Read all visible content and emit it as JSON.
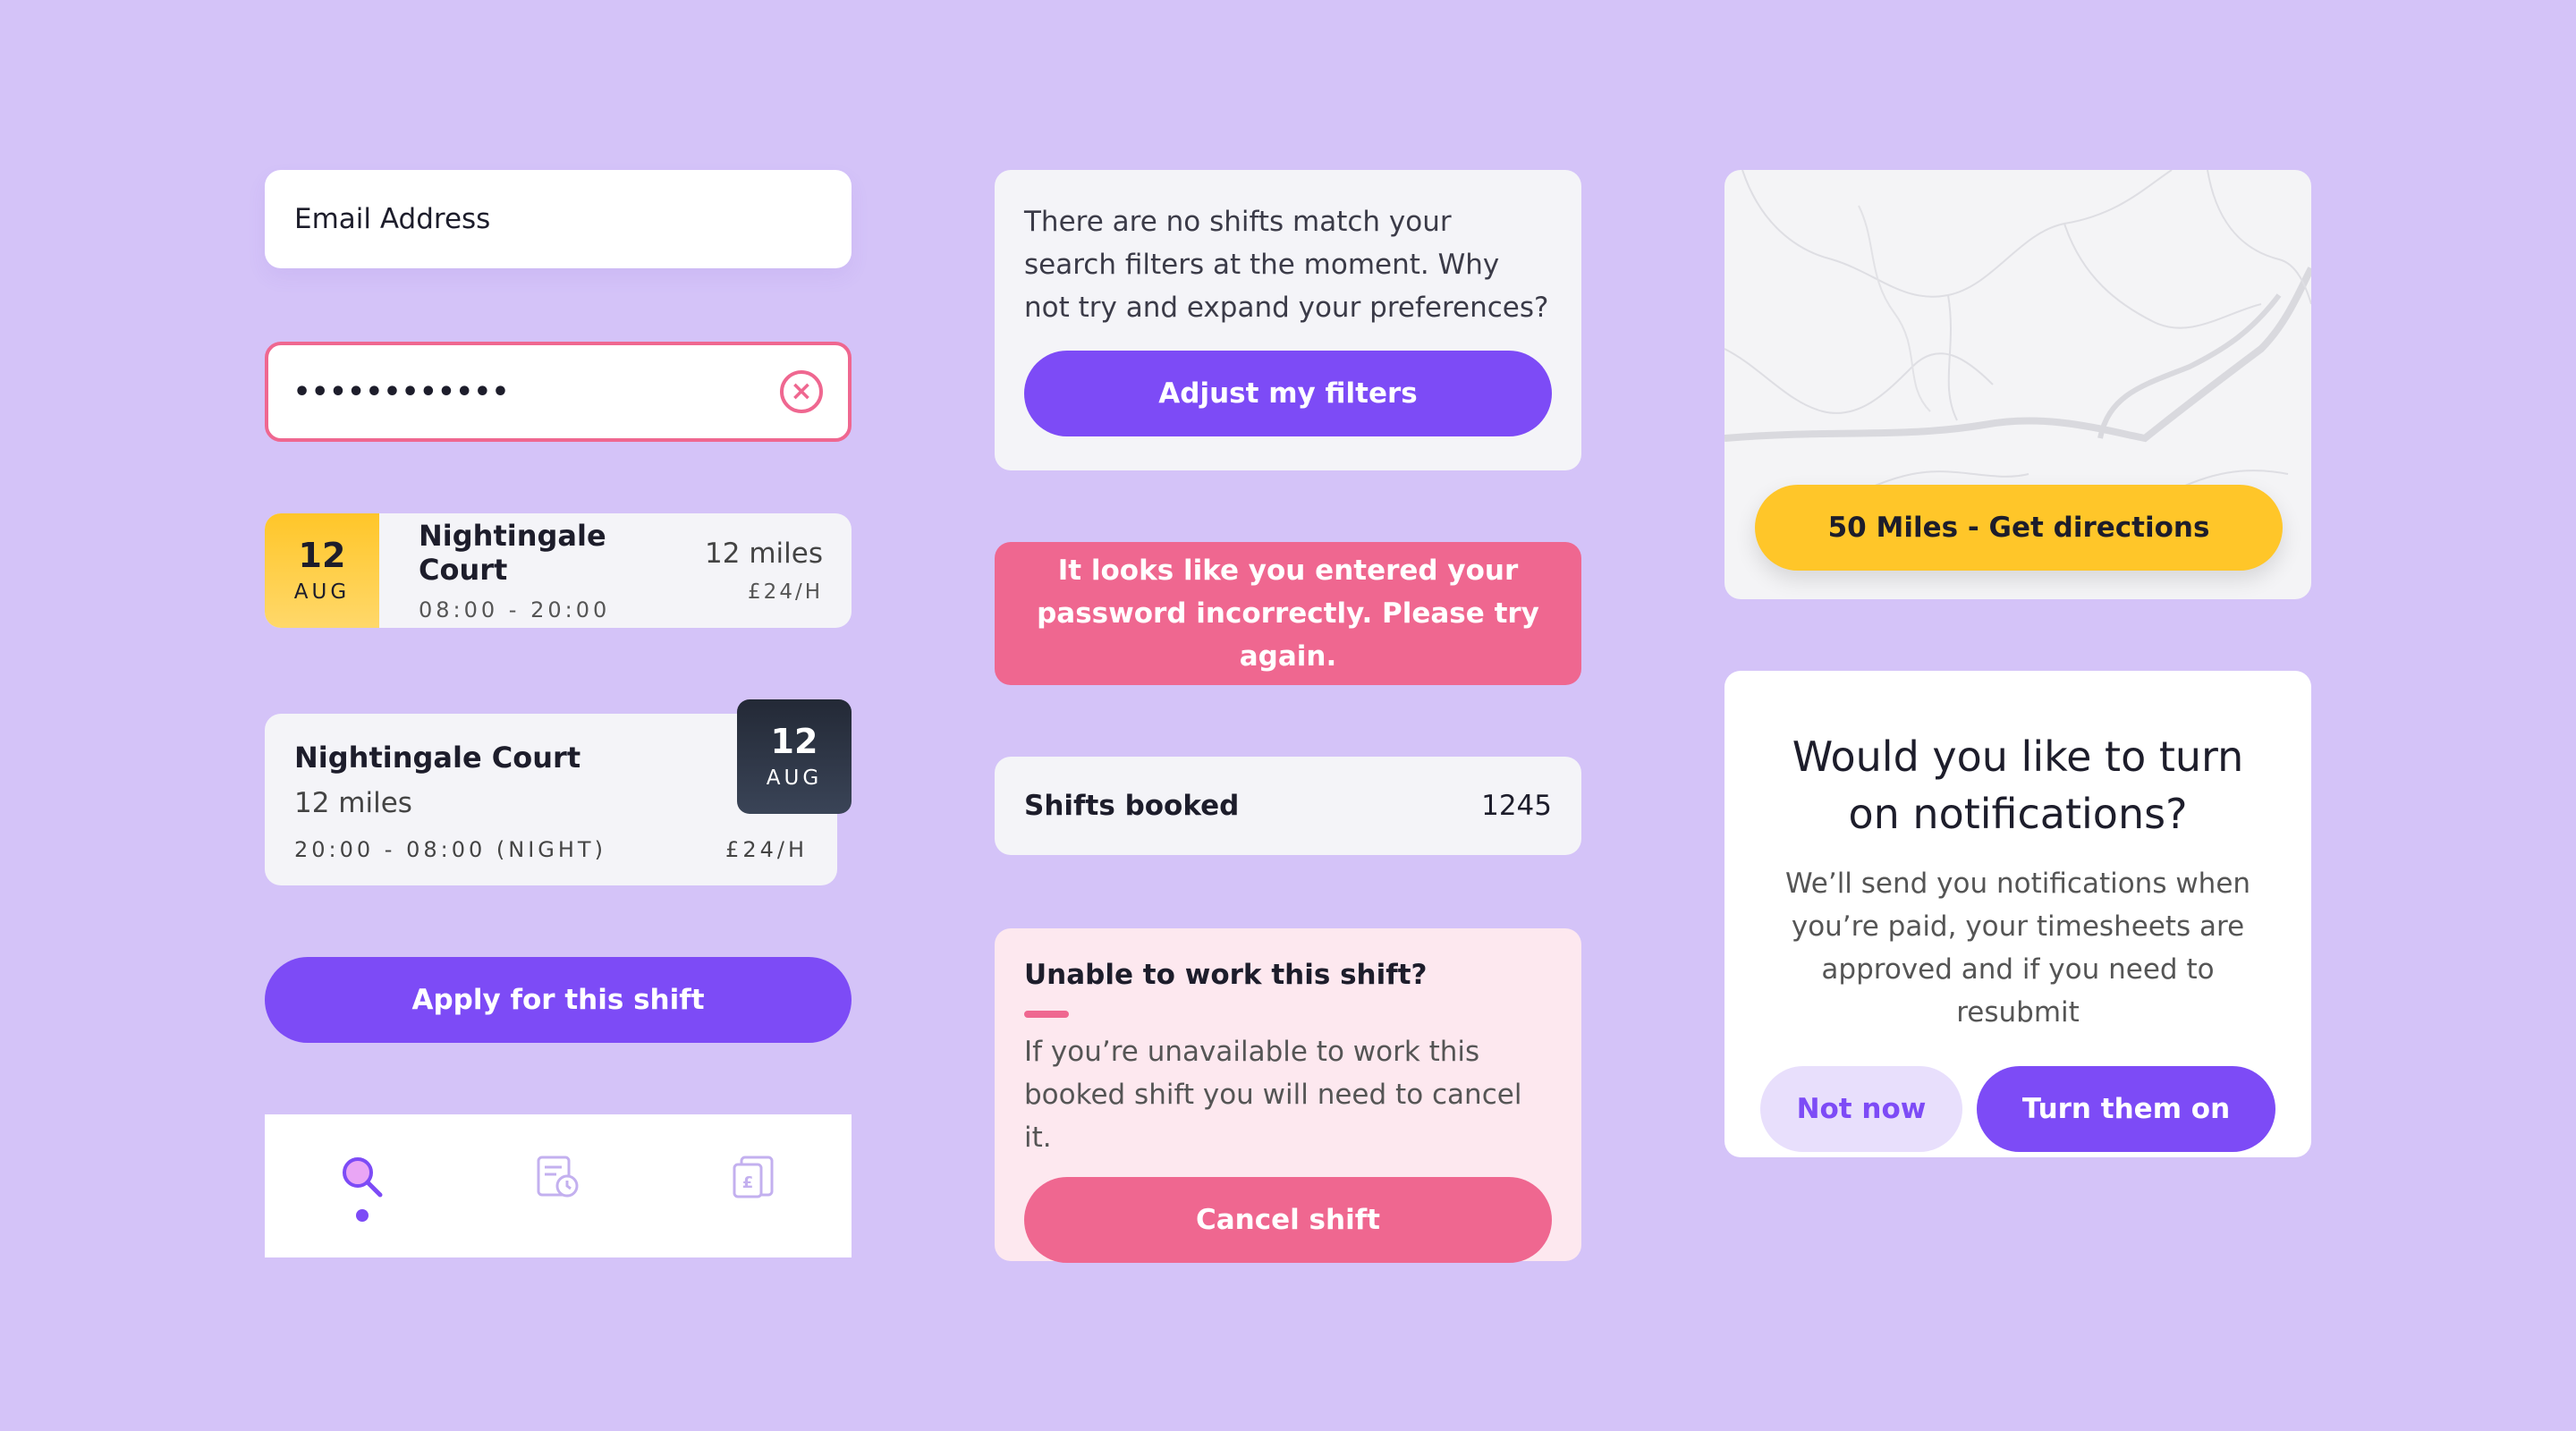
{
  "login": {
    "email_placeholder": "Email Address",
    "password_value": "••••••••••••"
  },
  "shift_card_1": {
    "day": "12",
    "month": "AUG",
    "name": "Nightingale Court",
    "time": "08:00 - 20:00",
    "distance": "12 miles",
    "rate": "£24/H"
  },
  "shift_card_2": {
    "name": "Nightingale Court",
    "distance": "12 miles",
    "time": "20:00 - 08:00 (NIGHT)",
    "rate": "£24/H",
    "day": "12",
    "month": "AUG"
  },
  "apply_button": "Apply for this shift",
  "tab_bar": {
    "tabs": [
      {
        "icon": "search-icon",
        "active": true
      },
      {
        "icon": "timesheet-icon",
        "active": false
      },
      {
        "icon": "payslip-icon",
        "active": false
      }
    ]
  },
  "no_results": {
    "message": "There are no shifts match your search filters at the moment. Why not try and expand your preferences?",
    "button": "Adjust my filters"
  },
  "error_banner": "It looks like you entered your password incorrectly. Please try again.",
  "stat": {
    "label": "Shifts booked",
    "value": "1245"
  },
  "cancel_card": {
    "title": "Unable to work this shift?",
    "body": "If you’re unavailable to work this booked shift you will need to cancel it.",
    "button": "Cancel shift"
  },
  "map_card": {
    "button": "50 Miles - Get directions"
  },
  "notification_prompt": {
    "title": "Would you like to turn on notifications?",
    "body": "We’ll send you notifications when you’re paid, your timesheets are approved and if you need to resubmit",
    "decline": "Not now",
    "accept": "Turn them on"
  },
  "colors": {
    "background": "#d4c3f8",
    "primary": "#7d4bf6",
    "danger": "#ef6790",
    "accent": "#ffc629",
    "dark": "#232936"
  }
}
